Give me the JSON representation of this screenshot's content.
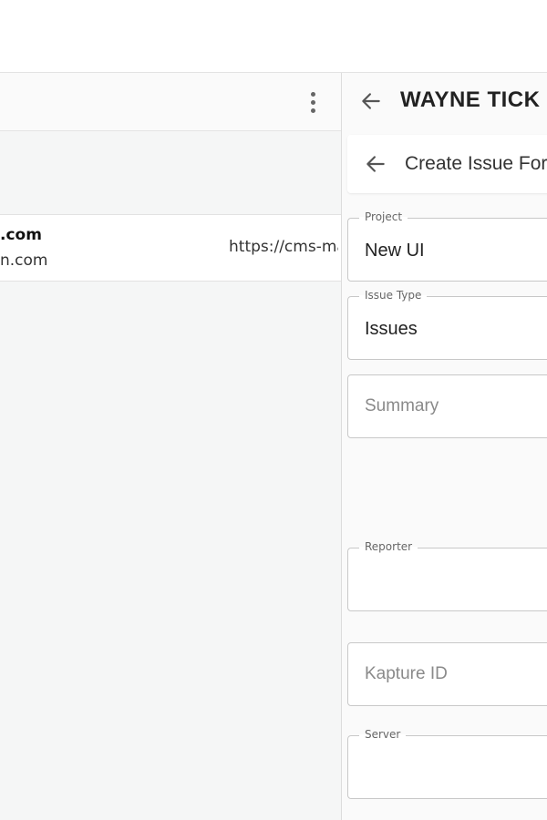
{
  "left": {
    "row": {
      "name": ".com",
      "email": "n.com",
      "url": "https://cms-ma"
    }
  },
  "panel": {
    "title": "WAYNE TICK",
    "form_title": "Create Issue For",
    "fields": {
      "project": {
        "label": "Project",
        "value": "New UI"
      },
      "issue_type": {
        "label": "Issue Type",
        "value": "Issues"
      },
      "summary": {
        "placeholder": "Summary"
      },
      "reporter": {
        "label": "Reporter",
        "value": ""
      },
      "kapture_id": {
        "placeholder": "Kapture ID"
      },
      "server": {
        "label": "Server",
        "value": ""
      }
    }
  },
  "icons": {
    "menu": "more-vertical-icon",
    "back": "arrow-left-icon"
  },
  "colors": {
    "left_background": "#f5f6f6",
    "panel_background": "#fafafa",
    "field_border": "#c8c8c8"
  }
}
